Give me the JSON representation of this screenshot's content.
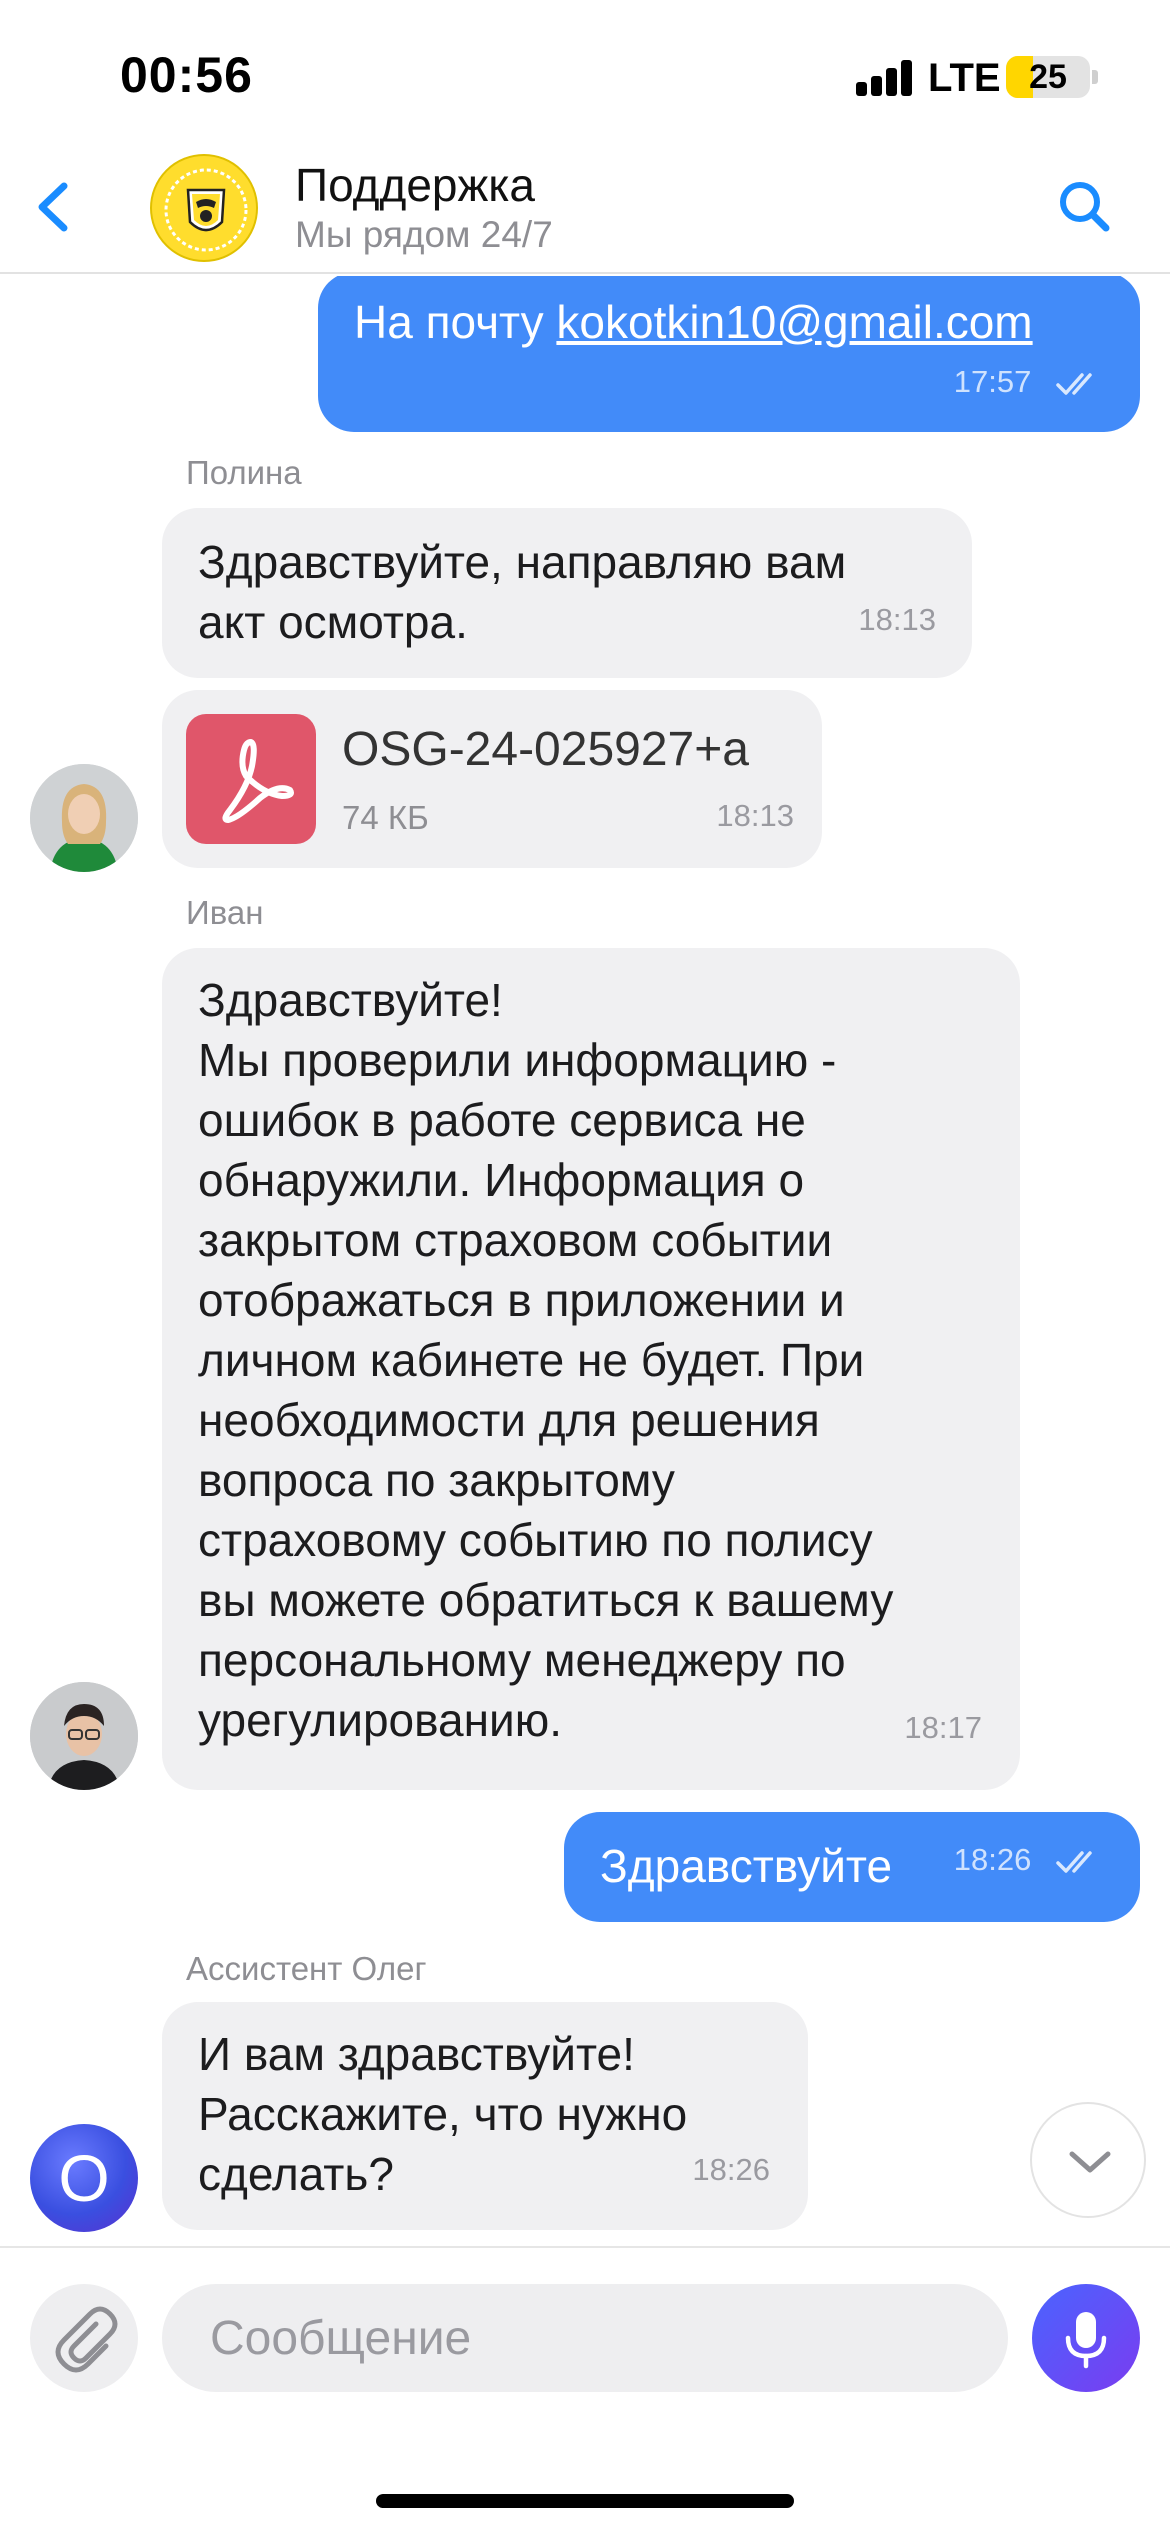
{
  "status_bar": {
    "time": "00:56",
    "network": "LTE",
    "battery_level": "25"
  },
  "header": {
    "title": "Поддержка",
    "subtitle": "Мы рядом 24/7"
  },
  "messages": [
    {
      "direction": "out",
      "text_prefix": "На почту ",
      "email": "kokotkin10@gmail.com",
      "time": "17:57"
    },
    {
      "direction": "in",
      "sender": "Полина",
      "text_lines": [
        "Здравствуйте, направляю вам",
        "акт осмотра."
      ],
      "time": "18:13"
    },
    {
      "direction": "in",
      "type": "file",
      "file_name": "OSG-24-025927+a",
      "file_size": "74 КБ",
      "time": "18:13"
    },
    {
      "direction": "in",
      "sender": "Иван",
      "text_lines": [
        "Здравствуйте!",
        "Мы проверили информацию -",
        "ошибок в работе сервиса не",
        "обнаружили. Информация о",
        "закрытом страховом событии",
        "отображаться в приложении и",
        "личном кабинете не будет. При",
        "необходимости для решения",
        "вопроса по закрытому",
        "страховому событию по полису",
        "вы можете обратиться к вашему",
        "персональному менеджеру по",
        "урегулированию."
      ],
      "time": "18:17"
    },
    {
      "direction": "out",
      "text": "Здравствуйте",
      "time": "18:26"
    },
    {
      "direction": "in",
      "sender": "Ассистент Олег",
      "text_lines": [
        "И вам здравствуйте!",
        "Расскажите, что нужно",
        "сделать?"
      ],
      "time": "18:26",
      "avatar_letter": "O"
    }
  ],
  "composer": {
    "placeholder": "Сообщение"
  },
  "colors": {
    "outgoing_bubble": "#428bf9",
    "incoming_bubble": "#f0f0f2",
    "accent_blue": "#1a8cff",
    "logo_yellow": "#ffdd2d",
    "pdf_icon": "#e0566a",
    "mic_gradient_start": "#4a64ff",
    "mic_gradient_end": "#7a3cf0"
  },
  "icons": [
    "back-chevron-icon",
    "tinkoff-logo-icon",
    "search-icon",
    "pdf-icon",
    "double-check-icon",
    "scroll-down-chevron-icon",
    "paperclip-icon",
    "microphone-icon"
  ]
}
